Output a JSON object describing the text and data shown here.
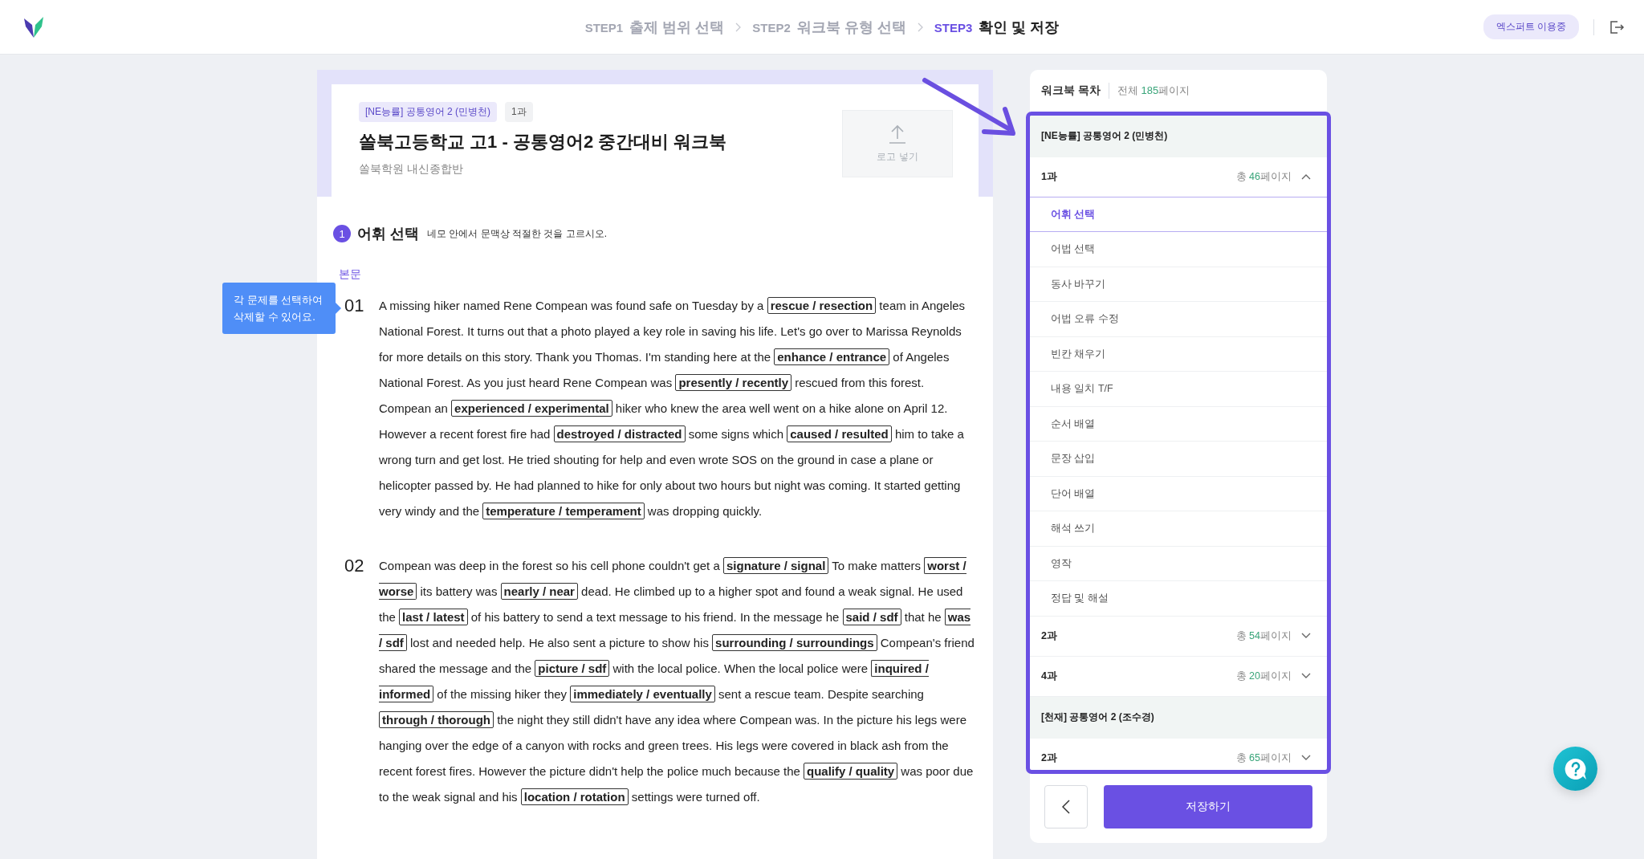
{
  "header": {
    "steps": [
      {
        "step": "STEP1",
        "label": "출제 범위 선택",
        "selected": false
      },
      {
        "step": "STEP2",
        "label": "워크북 유형 선택",
        "selected": false
      },
      {
        "step": "STEP3",
        "label": "확인 및 저장",
        "selected": true
      }
    ],
    "badge": "엑스퍼트 이용중"
  },
  "document": {
    "tags": [
      {
        "text": "[NE능률] 공통영어 2 (민병천)",
        "kind": "textbook"
      },
      {
        "text": "1과",
        "kind": "lesson"
      }
    ],
    "title": "쏠북고등학교 고1 - 공통영어2 중간대비 워크북",
    "subtitle": "쏠북학원 내신종합반",
    "logo_button": "로고 넣기",
    "section": {
      "number": "1",
      "title": "어휘 선택",
      "instruction": "네모 안에서 문맥상 적절한 것을 고르시오."
    },
    "passage_label": "본문",
    "passages": [
      {
        "number": "01",
        "segments": [
          {
            "kind": "text",
            "text": "A missing hiker named Rene Compean was found safe on Tuesday by a "
          },
          {
            "kind": "choice",
            "text": "rescue / resection"
          },
          {
            "kind": "text",
            "text": " team in Angeles National Forest. It turns out that a photo played a key role in saving his life. Let's go over to Marissa Reynolds for more details on this story. Thank you Thomas. I'm standing here at the "
          },
          {
            "kind": "choice",
            "text": "enhance / entrance"
          },
          {
            "kind": "text",
            "text": " of Angeles National Forest. As you just heard Rene Compean was "
          },
          {
            "kind": "choice",
            "text": "presently / recently"
          },
          {
            "kind": "text",
            "text": " rescued from this forest. Compean an "
          },
          {
            "kind": "choice",
            "text": "experienced / experimental"
          },
          {
            "kind": "text",
            "text": " hiker who knew the area well went on a hike alone on April 12. However a recent forest fire had "
          },
          {
            "kind": "choice",
            "text": "destroyed / distracted"
          },
          {
            "kind": "text",
            "text": " some signs which "
          },
          {
            "kind": "choice",
            "text": "caused / resulted"
          },
          {
            "kind": "text",
            "text": " him to take a wrong turn and get lost. He tried shouting for help and even wrote SOS on the ground in case a plane or helicopter passed by. He had planned to hike for only about two hours but night was coming. It started getting very windy and the "
          },
          {
            "kind": "choice",
            "text": "temperature / temperament"
          },
          {
            "kind": "text",
            "text": " was dropping quickly."
          }
        ]
      },
      {
        "number": "02",
        "segments": [
          {
            "kind": "text",
            "text": "Compean was deep in the forest so his cell phone couldn't get a "
          },
          {
            "kind": "choice",
            "text": "signature / signal"
          },
          {
            "kind": "text",
            "text": " To make matters "
          },
          {
            "kind": "choice",
            "text": "worst / worse"
          },
          {
            "kind": "text",
            "text": " its battery was "
          },
          {
            "kind": "choice",
            "text": "nearly / near"
          },
          {
            "kind": "text",
            "text": " dead. He climbed up to a higher spot and found a weak signal. He used the "
          },
          {
            "kind": "choice",
            "text": "last / latest"
          },
          {
            "kind": "text",
            "text": " of his battery to send a text message to his friend. In the message he "
          },
          {
            "kind": "choice",
            "text": "said / sdf"
          },
          {
            "kind": "text",
            "text": " that he "
          },
          {
            "kind": "choice",
            "text": "was / sdf"
          },
          {
            "kind": "text",
            "text": " lost and needed help. He also sent a picture to show his "
          },
          {
            "kind": "choice",
            "text": "surrounding / surroundings"
          },
          {
            "kind": "text",
            "text": "  Compean's friend shared the message and the "
          },
          {
            "kind": "choice",
            "text": "picture / sdf"
          },
          {
            "kind": "text",
            "text": " with the local police. When the local police were "
          },
          {
            "kind": "choice",
            "text": "inquired / informed"
          },
          {
            "kind": "text",
            "text": " of the missing hiker they "
          },
          {
            "kind": "choice",
            "text": "immediately / eventually"
          },
          {
            "kind": "text",
            "text": " sent a rescue team. Despite searching "
          },
          {
            "kind": "choice",
            "text": "through / thorough"
          },
          {
            "kind": "text",
            "text": " the night they still didn't have any idea where Compean was. In the picture his legs were hanging over the edge of a canyon with rocks and green trees. His legs were covered in black ash from the recent forest fires. However the picture didn't help the police much because the "
          },
          {
            "kind": "choice",
            "text": "qualify / quality"
          },
          {
            "kind": "text",
            "text": " was poor due to the weak signal and his "
          },
          {
            "kind": "choice",
            "text": "location / rotation"
          },
          {
            "kind": "text",
            "text": " settings were turned off."
          }
        ]
      }
    ]
  },
  "tooltip": "각 문제를 선택하여\n삭제할 수 있어요.",
  "toc": {
    "title": "워크북 목차",
    "total_prefix": "전체",
    "total_pages": "185",
    "total_suffix": "페이지",
    "groups": [
      {
        "title": "[NE능률] 공통영어 2 (민병천)",
        "lessons": [
          {
            "name": "1과",
            "prefix": "총",
            "pages": "46",
            "suffix": "페이지",
            "expanded": true,
            "items": [
              {
                "label": "어휘 선택",
                "selected": true
              },
              {
                "label": "어법 선택",
                "selected": false
              },
              {
                "label": "동사 바꾸기",
                "selected": false
              },
              {
                "label": "어법 오류 수정",
                "selected": false
              },
              {
                "label": "빈칸 채우기",
                "selected": false
              },
              {
                "label": "내용 일치 T/F",
                "selected": false
              },
              {
                "label": "순서 배열",
                "selected": false
              },
              {
                "label": "문장 삽입",
                "selected": false
              },
              {
                "label": "단어 배열",
                "selected": false
              },
              {
                "label": "해석 쓰기",
                "selected": false
              },
              {
                "label": "영작",
                "selected": false
              },
              {
                "label": "정답 및 해설",
                "selected": false
              }
            ]
          },
          {
            "name": "2과",
            "prefix": "총",
            "pages": "54",
            "suffix": "페이지",
            "expanded": false
          },
          {
            "name": "4과",
            "prefix": "총",
            "pages": "20",
            "suffix": "페이지",
            "expanded": false
          }
        ]
      },
      {
        "title": "[천재] 공통영어 2 (조수경)",
        "lessons": [
          {
            "name": "2과",
            "prefix": "총",
            "pages": "65",
            "suffix": "페이지",
            "expanded": false
          }
        ]
      }
    ]
  },
  "actions": {
    "save": "저장하기"
  }
}
